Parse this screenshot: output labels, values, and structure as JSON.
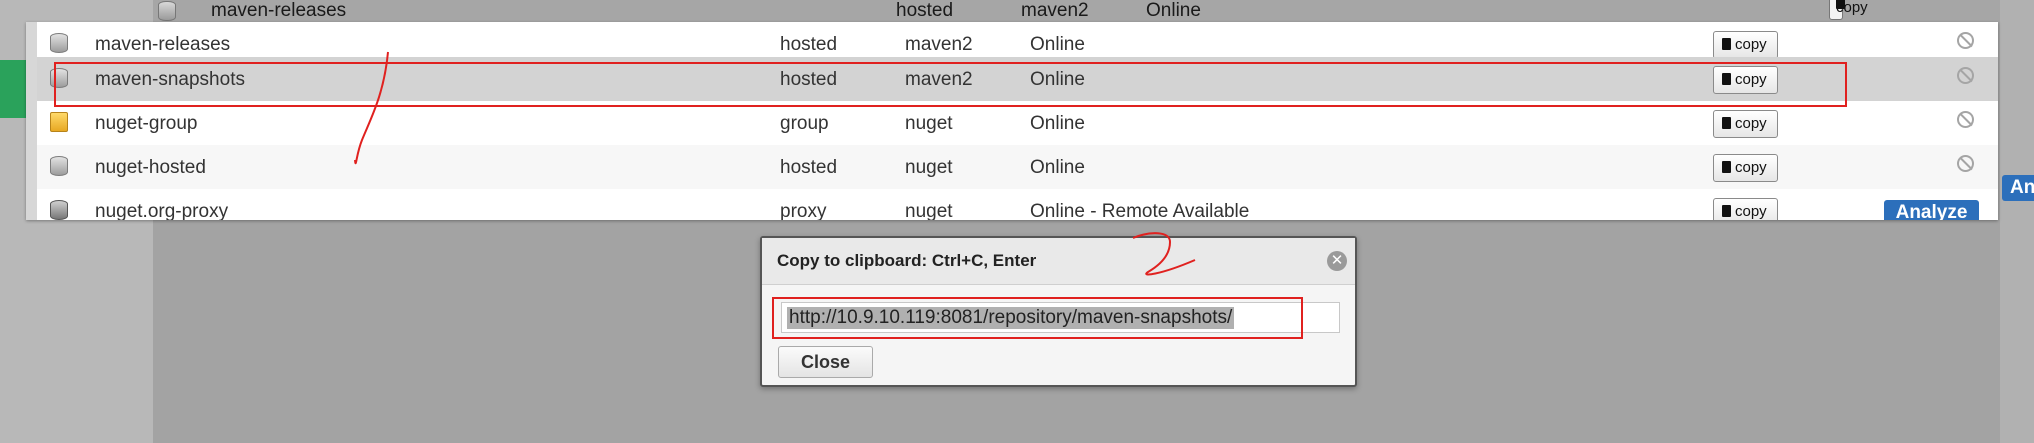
{
  "background_row": {
    "name": "maven-releases",
    "type": "hosted",
    "format": "maven2",
    "status": "Online",
    "copy_label": "copy"
  },
  "rows": [
    {
      "name": "maven-releases",
      "type": "hosted",
      "format": "maven2",
      "status": "Online",
      "icon": "database-icon",
      "copy_label": "copy",
      "action": "ban-icon",
      "selected": false
    },
    {
      "name": "maven-snapshots",
      "type": "hosted",
      "format": "maven2",
      "status": "Online",
      "icon": "database-icon",
      "copy_label": "copy",
      "action": "ban-icon",
      "selected": true
    },
    {
      "name": "nuget-group",
      "type": "group",
      "format": "nuget",
      "status": "Online",
      "icon": "folder-group-icon",
      "copy_label": "copy",
      "action": "ban-icon",
      "selected": false
    },
    {
      "name": "nuget-hosted",
      "type": "hosted",
      "format": "nuget",
      "status": "Online",
      "icon": "database-icon",
      "copy_label": "copy",
      "action": "ban-icon",
      "selected": false
    },
    {
      "name": "nuget.org-proxy",
      "type": "proxy",
      "format": "nuget",
      "status": "Online - Remote Available",
      "icon": "proxy-database-icon",
      "copy_label": "copy",
      "action": "Analyze",
      "selected": false
    }
  ],
  "analyze_side_label": "An",
  "dialog": {
    "title": "Copy to clipboard: Ctrl+C, Enter",
    "url": "http://10.9.10.119:8081/repository/maven-snapshots/",
    "close_label": "Close"
  },
  "colors": {
    "accent_blue": "#2c6fbb",
    "annotation_red": "#e0211f",
    "green": "#2aa25b"
  }
}
